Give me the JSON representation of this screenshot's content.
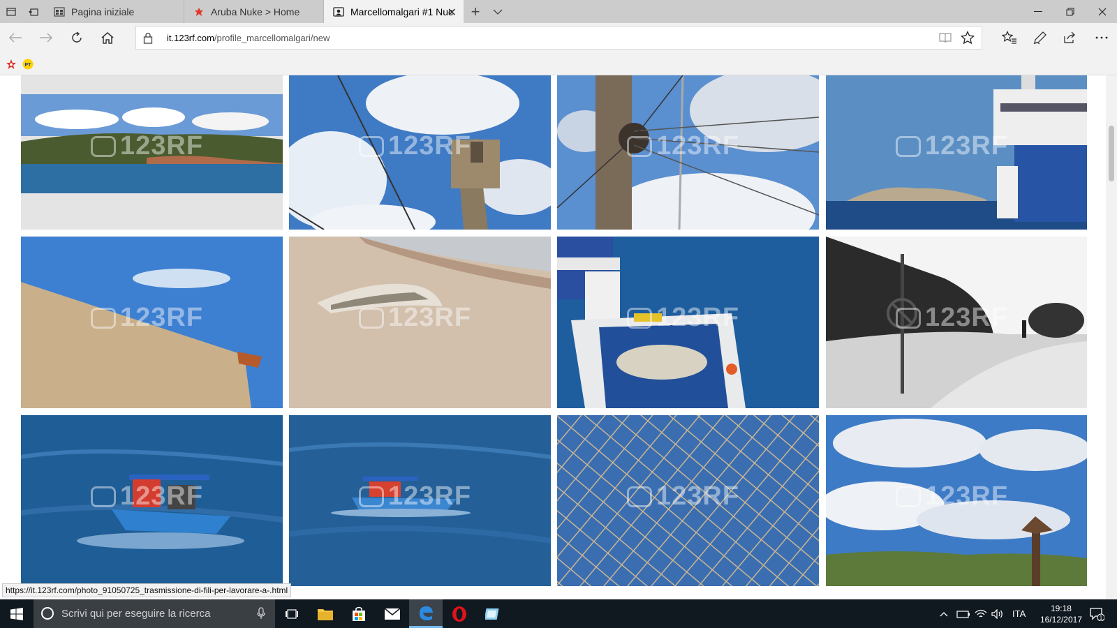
{
  "browser": {
    "tabs": [
      {
        "title": "Pagina iniziale",
        "active": false
      },
      {
        "title": "Aruba Nuke > Home",
        "active": false
      },
      {
        "title": "Marcellomalgari #1 Nuc",
        "active": true
      }
    ],
    "address": {
      "domain": "it.123rf.com",
      "path": "/profile_marcellomalgari/new"
    },
    "favorites": [
      {
        "icon": "red-star-icon"
      },
      {
        "icon": "poste-italiane-icon",
        "label": "PT"
      }
    ]
  },
  "gallery": {
    "watermark": "123RF",
    "photos": [
      {
        "subject": "island-coast"
      },
      {
        "subject": "crane-sky"
      },
      {
        "subject": "mast-cables"
      },
      {
        "subject": "ferry-sea"
      },
      {
        "subject": "wall-sky"
      },
      {
        "subject": "driftwood-beach"
      },
      {
        "subject": "boat-deck-ropes"
      },
      {
        "subject": "bw-path-sign"
      },
      {
        "subject": "fishing-boat-1"
      },
      {
        "subject": "fishing-boat-2"
      },
      {
        "subject": "fishing-net"
      },
      {
        "subject": "clouds-post"
      }
    ]
  },
  "status_url": "https://it.123rf.com/photo_91050725_trasmissione-di-fili-per-lavorare-a-.html",
  "taskbar": {
    "search_placeholder": "Scrivi qui per eseguire la ricerca",
    "language": "ITA",
    "time": "19:18",
    "date": "16/12/2017",
    "notifications": "1"
  },
  "colors": {
    "accent": "#0078d7",
    "taskbar": "#101820",
    "chrome": "#f2f2f2"
  }
}
